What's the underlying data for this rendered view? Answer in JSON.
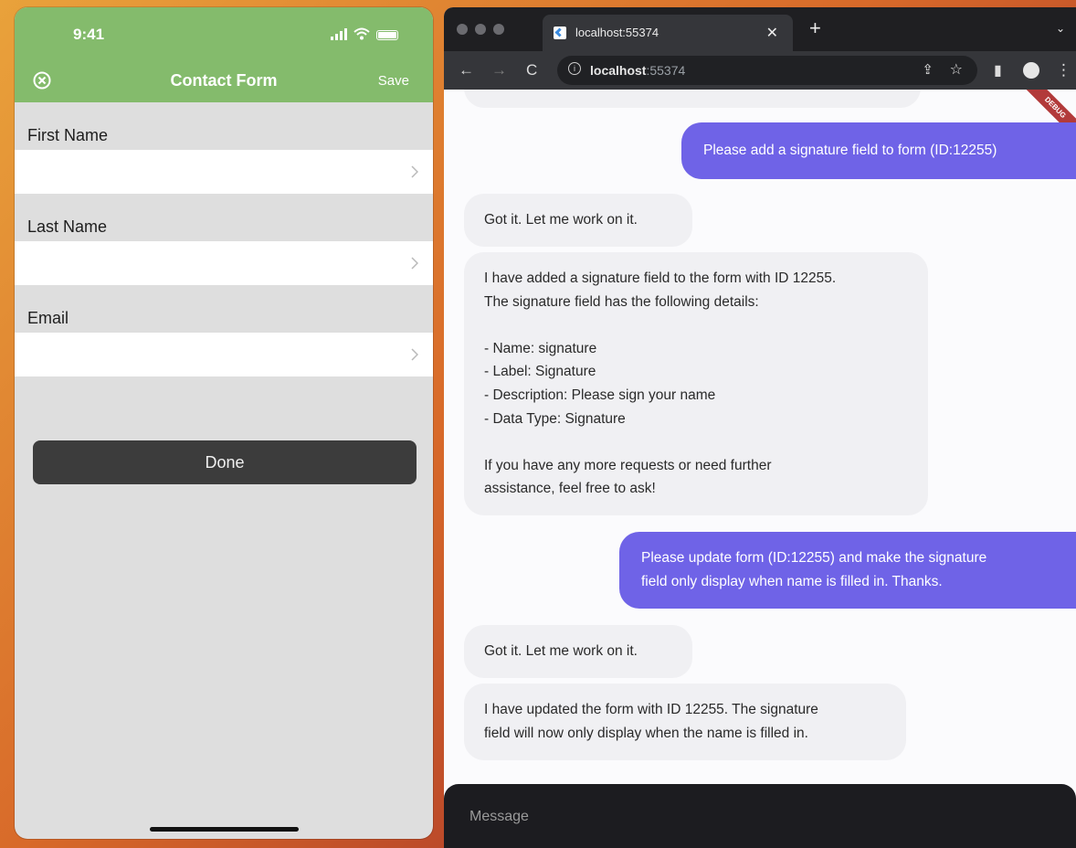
{
  "phone": {
    "time": "9:41",
    "nav": {
      "title": "Contact Form",
      "save": "Save"
    },
    "fields": [
      {
        "label": "First Name",
        "value": ""
      },
      {
        "label": "Last Name",
        "value": ""
      },
      {
        "label": "Email",
        "value": ""
      }
    ],
    "done": "Done",
    "colors": {
      "header": "#84bb6c",
      "background": "#dedede",
      "done_button": "#3c3c3c"
    }
  },
  "browser": {
    "tab_title": "localhost:55374",
    "url_host": "localhost",
    "url_port": ":55374",
    "debug_banner": "DEBUG",
    "composer_placeholder": "Message",
    "colors": {
      "user_bubble": "#6f63e7",
      "bot_bubble": "#f0f0f3"
    },
    "messages": [
      {
        "role": "user",
        "text": "Please add a signature field to form (ID:12255)"
      },
      {
        "role": "bot",
        "text": "Got it. Let me work on it."
      },
      {
        "role": "bot",
        "text": "I have added a signature field to the form with ID 12255.\nThe signature field has the following details:\n\n- Name: signature\n- Label: Signature\n- Description: Please sign your name\n- Data Type: Signature\n\nIf you have any more requests or need further\nassistance, feel free to ask!"
      },
      {
        "role": "user",
        "text": "Please update form (ID:12255) and make the signature\nfield only display when name is filled in. Thanks."
      },
      {
        "role": "bot",
        "text": "Got it. Let me work on it."
      },
      {
        "role": "bot",
        "text": "I have updated the form with ID 12255. The signature\nfield will now only display when the name is filled in."
      }
    ]
  }
}
